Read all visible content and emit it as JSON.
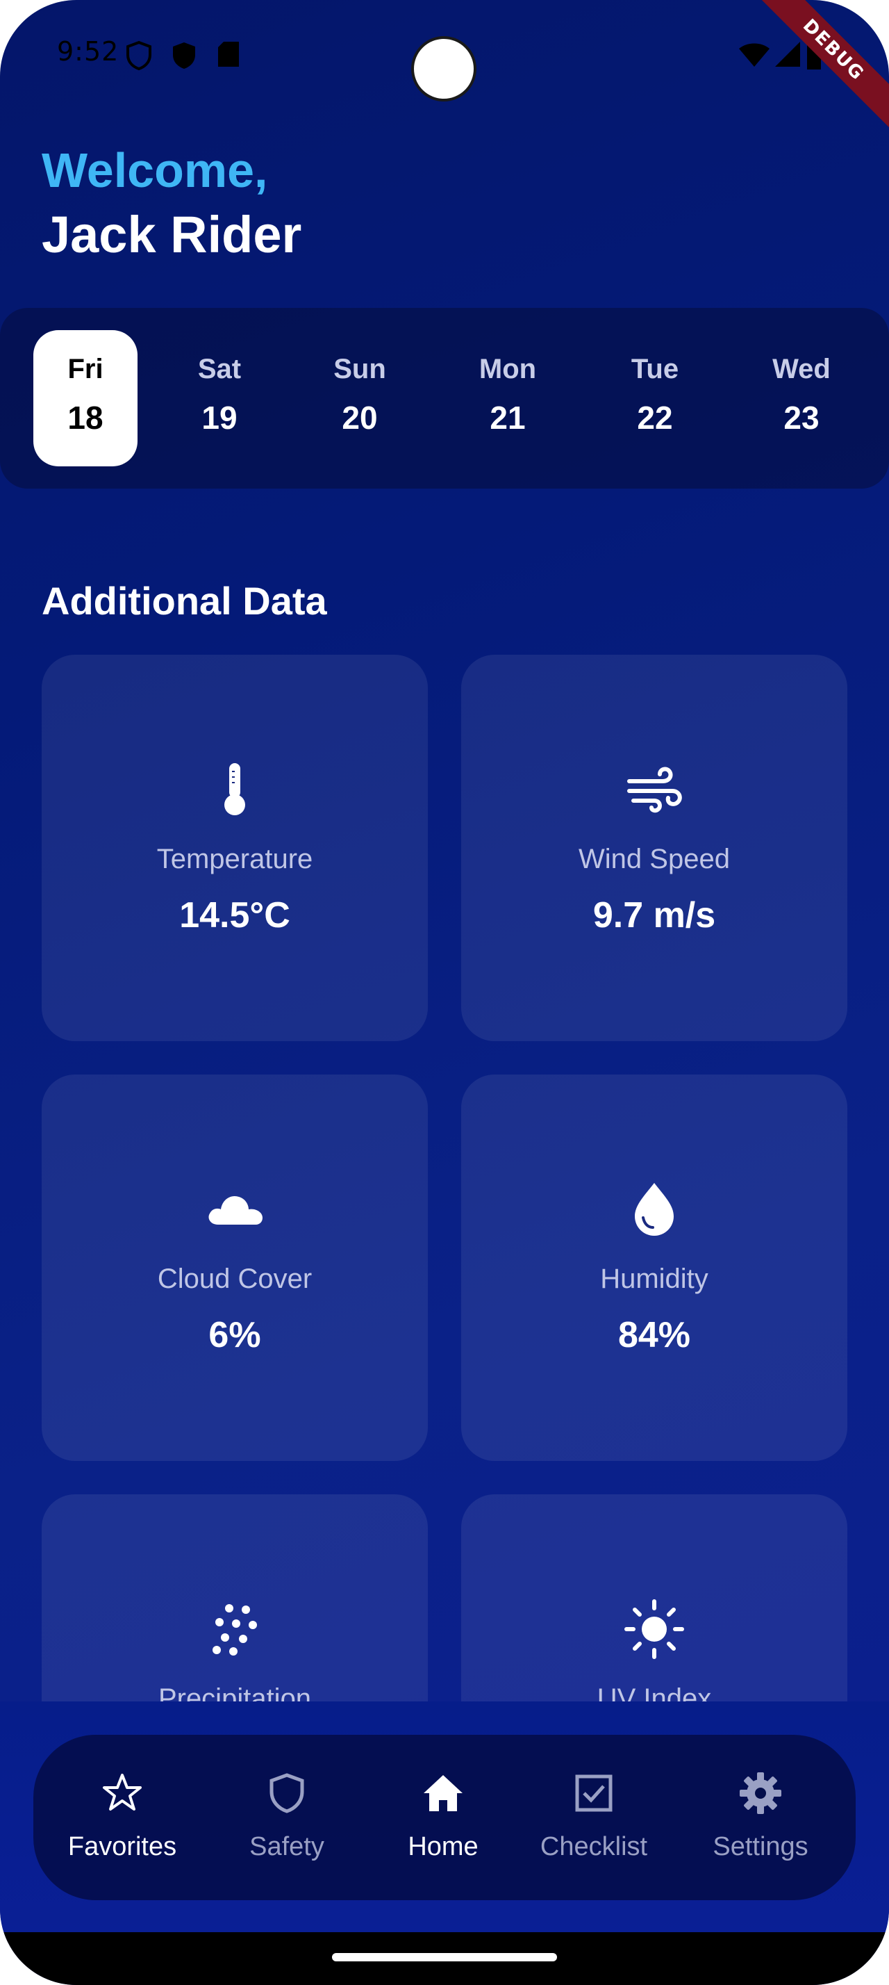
{
  "status_bar": {
    "time": "9:52",
    "icons": [
      "shield-outline-icon",
      "shield-filled-icon",
      "sd-card-icon",
      "wifi-icon",
      "signal-icon",
      "battery-icon"
    ]
  },
  "debug_banner": "DEBUG",
  "header": {
    "welcome": "Welcome,",
    "user_name": "Jack Rider"
  },
  "days": [
    {
      "name": "Fri",
      "num": "18",
      "selected": true
    },
    {
      "name": "Sat",
      "num": "19",
      "selected": false
    },
    {
      "name": "Sun",
      "num": "20",
      "selected": false
    },
    {
      "name": "Mon",
      "num": "21",
      "selected": false
    },
    {
      "name": "Tue",
      "num": "22",
      "selected": false
    },
    {
      "name": "Wed",
      "num": "23",
      "selected": false
    }
  ],
  "section_title": "Additional Data",
  "cards": [
    {
      "label": "Temperature",
      "value": "14.5°C",
      "icon": "thermometer-icon"
    },
    {
      "label": "Wind Speed",
      "value": "9.7 m/s",
      "icon": "wind-icon"
    },
    {
      "label": "Cloud Cover",
      "value": "6%",
      "icon": "cloud-icon"
    },
    {
      "label": "Humidity",
      "value": "84%",
      "icon": "water-drop-icon"
    },
    {
      "label": "Precipitation",
      "value": "",
      "icon": "rain-dots-icon"
    },
    {
      "label": "UV Index",
      "value": "",
      "icon": "sun-icon"
    }
  ],
  "nav": {
    "items": [
      {
        "label": "Favorites",
        "icon": "star-icon",
        "active": true
      },
      {
        "label": "Safety",
        "icon": "shield-icon",
        "active": false
      },
      {
        "label": "Home",
        "icon": "home-icon",
        "active": true
      },
      {
        "label": "Checklist",
        "icon": "checkbox-icon",
        "active": false
      },
      {
        "label": "Settings",
        "icon": "gear-icon",
        "active": false
      }
    ]
  },
  "colors": {
    "accent": "#3fb6f5",
    "background_top": "#04166a",
    "background_bottom": "#0c1e90"
  }
}
